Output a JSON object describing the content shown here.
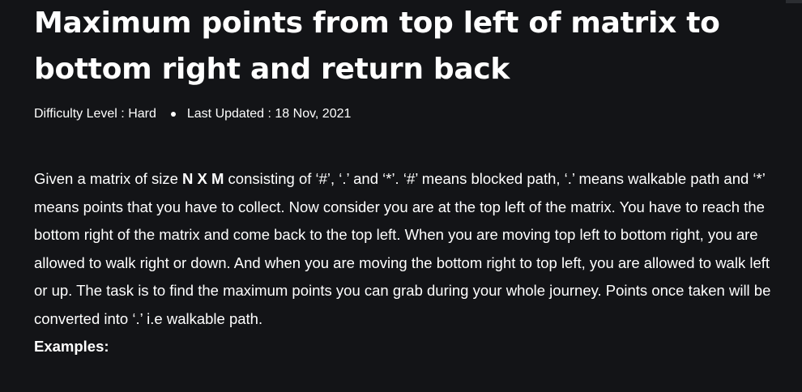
{
  "article": {
    "title": "Maximum points from top left of matrix to bottom right and return back",
    "difficulty_label": "Difficulty Level : Hard",
    "updated_label": "Last Updated : 18 Nov, 2021",
    "intro_1": "Given a matrix of size ",
    "intro_bold": "N X M",
    "intro_2": " consisting of ‘#’, ‘.’ and ‘*’. ‘#’ means blocked path, ‘.’ means walkable path and ‘*’ means points that you have to collect. Now consider you are at the top left of the matrix. You have to reach the bottom right of the matrix and come back to the top left. When you are moving top left to bottom right, you are allowed to walk right or down. And when you are moving the bottom right to top left, you are allowed to walk left or up. The task is to find the maximum points you can grab during your whole journey. Points once taken will be converted into ‘.’ i.e walkable path.",
    "examples_heading": "Examples:"
  }
}
